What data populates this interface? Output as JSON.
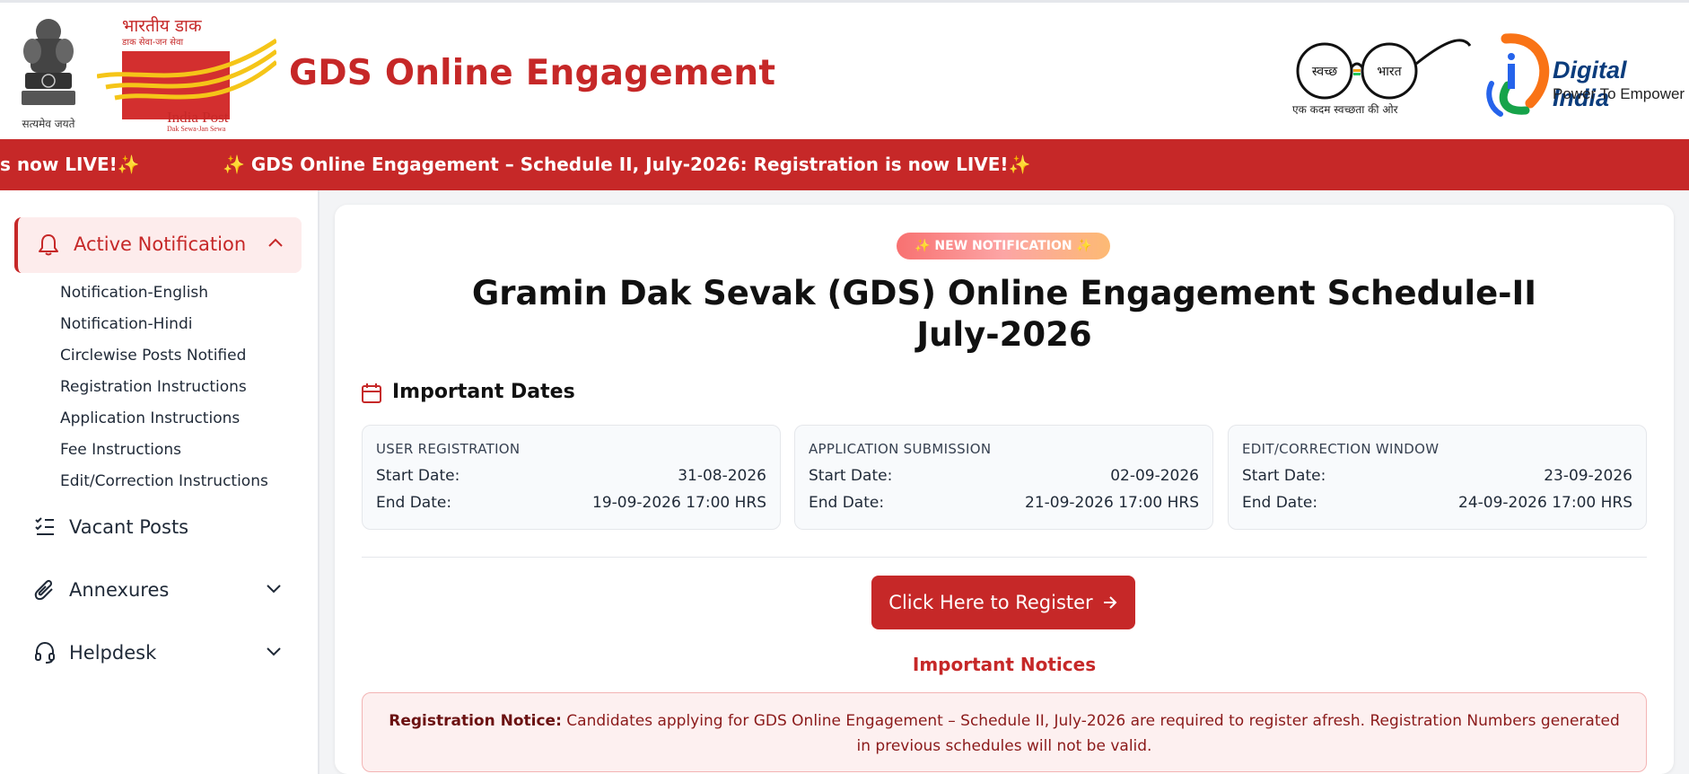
{
  "header": {
    "emblem_motto": "सत्यमेव जयते",
    "india_post": {
      "hindi_name": "भारतीय डाक",
      "hindi_tagline": "डाक सेवा-जन सेवा",
      "name": "India Post",
      "tagline": "Dak Sewa-Jan Sewa"
    },
    "title": "GDS Online Engagement",
    "swachh_bharat": {
      "left_lens": "स्वच्छ",
      "right_lens": "भारत",
      "tagline": "एक कदम स्वच्छता की ओर"
    },
    "digital_india": {
      "title": "Digital India",
      "subtitle": "Power To Empower"
    }
  },
  "ticker": {
    "items": [
      "s now LIVE!✨",
      "✨ GDS Online Engagement – Schedule II, July-2026: Registration is now LIVE!✨"
    ]
  },
  "sidebar": {
    "active": {
      "label": "Active Notification",
      "icon": "bell-icon",
      "subitems": [
        "Notification-English",
        "Notification-Hindi",
        "Circlewise Posts Notified",
        "Registration Instructions",
        "Application Instructions",
        "Fee Instructions",
        "Edit/Correction Instructions"
      ]
    },
    "items": [
      {
        "label": "Vacant Posts",
        "icon": "list-check-icon"
      },
      {
        "label": "Annexures",
        "icon": "paperclip-icon"
      },
      {
        "label": "Helpdesk",
        "icon": "headset-icon"
      }
    ]
  },
  "main": {
    "badge": "✨ NEW NOTIFICATION ✨",
    "title_line1": "Gramin Dak Sevak (GDS) Online Engagement Schedule-II",
    "title_line2": "July-2026",
    "dates_heading": "Important Dates",
    "date_boxes": [
      {
        "caption": "USER REGISTRATION",
        "start_label": "Start Date:",
        "start": "31-08-2026",
        "end_label": "End Date:",
        "end": "19-09-2026 17:00 HRS"
      },
      {
        "caption": "APPLICATION SUBMISSION",
        "start_label": "Start Date:",
        "start": "02-09-2026",
        "end_label": "End Date:",
        "end": "21-09-2026 17:00 HRS"
      },
      {
        "caption": "EDIT/CORRECTION WINDOW",
        "start_label": "Start Date:",
        "start": "23-09-2026",
        "end_label": "End Date:",
        "end": "24-09-2026 17:00 HRS"
      }
    ],
    "register_button": "Click Here to Register",
    "notices_heading": "Important Notices",
    "notice": {
      "label": "Registration Notice:",
      "text": " Candidates applying for GDS Online Engagement – Schedule II, July-2026 are required to register afresh. Registration Numbers generated in previous schedules will not be valid."
    }
  },
  "colors": {
    "brand_red": "#c62828",
    "active_bg": "#fdecec",
    "notice_bg": "#fdf0f0"
  }
}
